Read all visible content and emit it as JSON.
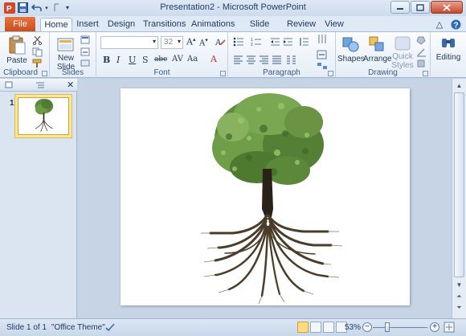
{
  "window": {
    "title": "Presentation2 - Microsoft PowerPoint"
  },
  "tabs": {
    "file": "File",
    "items": [
      "Home",
      "Insert",
      "Design",
      "Transitions",
      "Animations",
      "Slide Show",
      "Review",
      "View"
    ],
    "active": "Home"
  },
  "ribbon": {
    "clipboard": {
      "label": "Clipboard",
      "paste": "Paste"
    },
    "slides": {
      "label": "Slides",
      "new_slide_line1": "New",
      "new_slide_line2": "Slide"
    },
    "font": {
      "label": "Font",
      "size": "32"
    },
    "paragraph": {
      "label": "Paragraph"
    },
    "drawing": {
      "label": "Drawing",
      "shapes": "Shapes",
      "arrange": "Arrange",
      "quick_styles_line1": "Quick",
      "quick_styles_line2": "Styles"
    },
    "editing": {
      "label": "Editing"
    }
  },
  "slides_pane": {
    "slide_number": "1"
  },
  "status": {
    "slide": "Slide 1 of 1",
    "theme": "\"Office Theme\"",
    "zoom": "53%",
    "zoom_value": 53
  }
}
